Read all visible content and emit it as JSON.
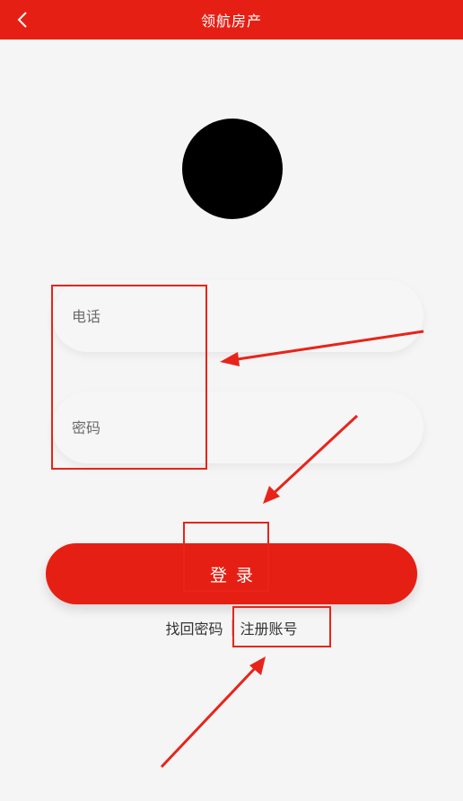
{
  "header": {
    "title": "领航房产",
    "background": "#e61f14",
    "back_icon": "chevron-left-icon"
  },
  "form": {
    "phone_placeholder": "电话",
    "password_placeholder": "密码",
    "login_label": "登录"
  },
  "links": {
    "recover_password": "找回密码",
    "register_account": "注册账号"
  },
  "colors": {
    "accent": "#e61f14",
    "annotation": "#e8241a"
  }
}
